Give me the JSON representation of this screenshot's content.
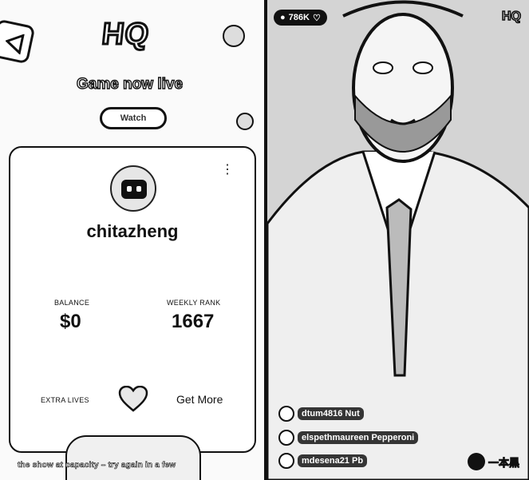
{
  "left": {
    "logo": "HQ",
    "game_status": "Game now live",
    "watch_button": "Watch",
    "profile": {
      "username": "chitazheng",
      "balance_label": "BALANCE",
      "balance_value": "$0",
      "weekly_rank_label": "WEEKLY RANK",
      "weekly_rank_value": "1667",
      "extra_lives_label": "EXTRA LIVES",
      "get_more_label": "Get More"
    },
    "footer_note": "the show at capacity – try again in a few"
  },
  "right": {
    "viewer_count": "786K",
    "logo": "HQ",
    "comments": [
      {
        "user": "dtum4816",
        "text": "Nut"
      },
      {
        "user": "elspethmaureen",
        "text": "Pepperoni"
      },
      {
        "user": "mdesena21",
        "text": "Pb"
      }
    ],
    "watermark": "一本黑"
  },
  "colors": {
    "ink": "#111111",
    "card_bg": "#ffffff",
    "panel_bg": "#fafafa"
  },
  "icons": [
    "back-arrow-icon",
    "more-vert-icon",
    "heart-icon",
    "person-icon",
    "viewer-heart-icon"
  ]
}
